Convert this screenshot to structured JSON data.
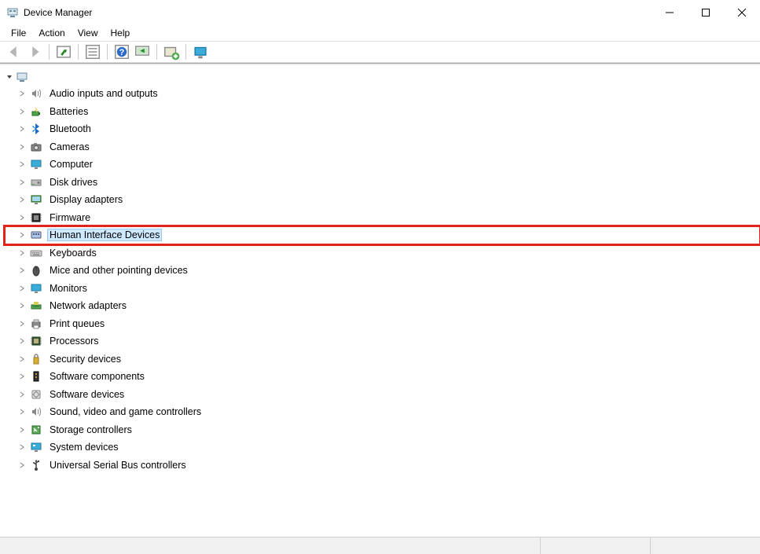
{
  "window": {
    "title": "Device Manager"
  },
  "menubar": {
    "file": "File",
    "action": "Action",
    "view": "View",
    "help": "Help"
  },
  "toolbar": {
    "back": "Back",
    "forward": "Forward",
    "show_hidden": "Show hidden devices",
    "properties": "Properties",
    "help": "Help",
    "scan": "Scan for hardware changes",
    "add_legacy": "Add legacy hardware",
    "devices_printers": "Devices and Printers"
  },
  "tree": {
    "root": "",
    "categories": [
      {
        "label": "Audio inputs and outputs",
        "icon": "speaker"
      },
      {
        "label": "Batteries",
        "icon": "battery"
      },
      {
        "label": "Bluetooth",
        "icon": "bluetooth"
      },
      {
        "label": "Cameras",
        "icon": "camera"
      },
      {
        "label": "Computer",
        "icon": "monitor"
      },
      {
        "label": "Disk drives",
        "icon": "disk"
      },
      {
        "label": "Display adapters",
        "icon": "display"
      },
      {
        "label": "Firmware",
        "icon": "chip"
      },
      {
        "label": "Human Interface Devices",
        "icon": "hid",
        "selected": true,
        "highlighted": true
      },
      {
        "label": "Keyboards",
        "icon": "keyboard"
      },
      {
        "label": "Mice and other pointing devices",
        "icon": "mouse"
      },
      {
        "label": "Monitors",
        "icon": "monitor"
      },
      {
        "label": "Network adapters",
        "icon": "network"
      },
      {
        "label": "Print queues",
        "icon": "printer"
      },
      {
        "label": "Processors",
        "icon": "cpu"
      },
      {
        "label": "Security devices",
        "icon": "security"
      },
      {
        "label": "Software components",
        "icon": "soft-comp"
      },
      {
        "label": "Software devices",
        "icon": "soft-dev"
      },
      {
        "label": "Sound, video and game controllers",
        "icon": "sound"
      },
      {
        "label": "Storage controllers",
        "icon": "storage"
      },
      {
        "label": "System devices",
        "icon": "system"
      },
      {
        "label": "Universal Serial Bus controllers",
        "icon": "usb"
      }
    ]
  }
}
